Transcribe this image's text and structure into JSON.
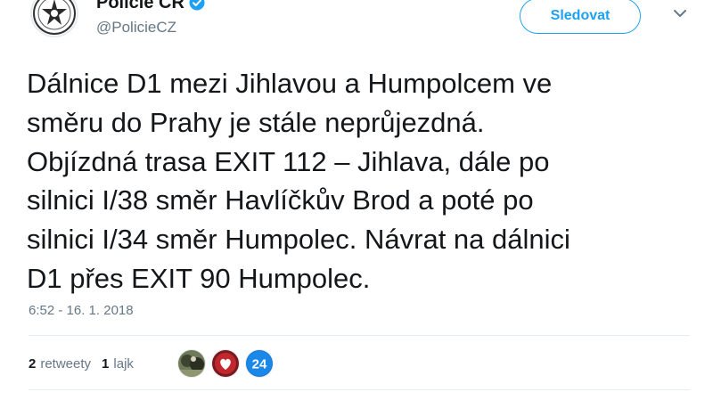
{
  "tweet": {
    "display_name": "Policie ČR",
    "handle": "@PolicieCZ",
    "verified_icon": "verified-badge-icon",
    "follow_label": "Sledovat",
    "text_lines": [
      "Dálnice D1 mezi Jihlavou a Humpolcem ve",
      "směru do Prahy je stále neprůjezdná.",
      "Objízdná trasa EXIT 112 – Jihlava, dále po",
      "silnici I/38 směr Havlíčkův Brod a poté po",
      "silnici I/34 směr Humpolec. Návrat na dálnici",
      "D1 přes EXIT 90 Humpolec."
    ],
    "timestamp": "6:52 - 16. 1. 2018",
    "retweets_count": "2",
    "retweets_label": "retweety",
    "likes_count": "1",
    "likes_label": "lajk",
    "facepile": [
      {
        "icon": "user-avatar-photo"
      },
      {
        "icon": "user-avatar-heart"
      },
      {
        "icon": "user-avatar-24",
        "text": "24"
      }
    ]
  },
  "colors": {
    "accent": "#1da1f2",
    "text": "#14171a",
    "secondary_text": "#657786",
    "divider": "#e6ecf0"
  }
}
